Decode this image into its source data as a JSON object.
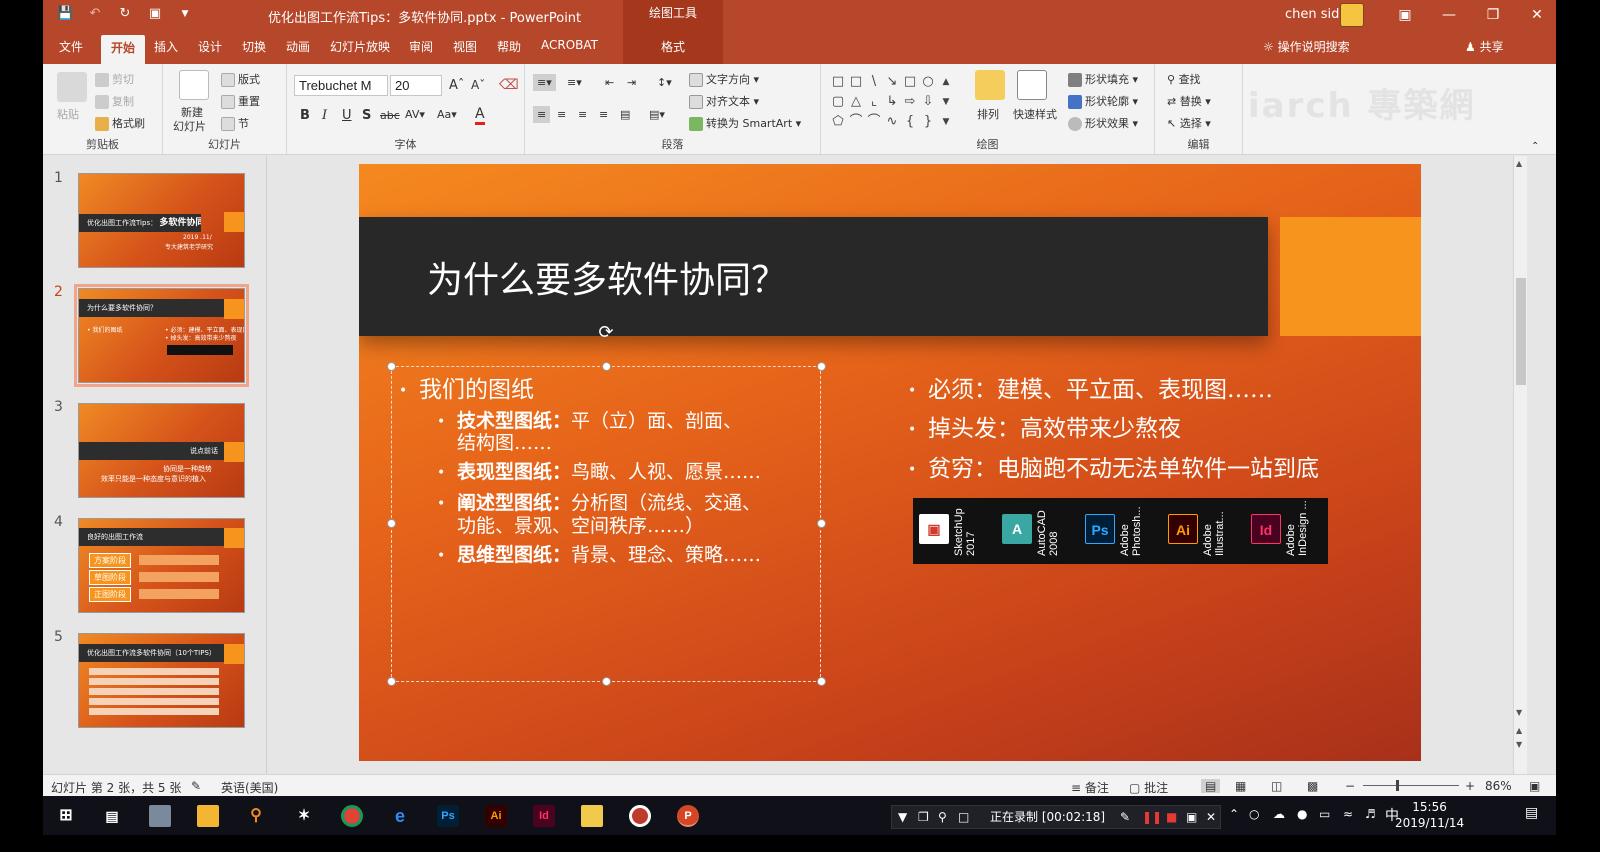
{
  "window": {
    "doc_title": "优化出图工作流Tips：多软件协同.pptx  -  PowerPoint",
    "contextual_tab_group": "绘图工具",
    "user_name": "chen sid"
  },
  "tabs": [
    "文件",
    "开始",
    "插入",
    "设计",
    "切换",
    "动画",
    "幻灯片放映",
    "审阅",
    "视图",
    "帮助",
    "ACROBAT",
    "格式"
  ],
  "tell_me": "操作说明搜索",
  "share": "共享",
  "ribbon": {
    "clipboard": {
      "label": "剪贴板",
      "paste": "粘贴",
      "cut": "剪切",
      "copy": "复制",
      "format_painter": "格式刷"
    },
    "slides": {
      "label": "幻灯片",
      "new_slide_1": "新建",
      "new_slide_2": "幻灯片",
      "layout": "版式",
      "reset": "重置",
      "section": "节"
    },
    "font": {
      "label": "字体",
      "font_name": "Trebuchet M",
      "font_size": "20"
    },
    "paragraph": {
      "label": "段落",
      "text_direction": "文字方向",
      "align_text": "对齐文本",
      "smartart": "转换为 SmartArt"
    },
    "drawing": {
      "label": "绘图",
      "arrange": "排列",
      "quick_styles": "快速样式",
      "shape_fill": "形状填充",
      "shape_outline": "形状轮廓",
      "shape_effects": "形状效果"
    },
    "editing": {
      "label": "编辑",
      "find": "查找",
      "replace": "替换",
      "select": "选择"
    },
    "watermark": "iarch 專築網"
  },
  "thumbnails": [
    {
      "num": "1",
      "bar": "优化出图工作流Tips：",
      "bar_big": "多软件协同",
      "sub1": "2019 .11/",
      "sub2": "专大建筑老学研究"
    },
    {
      "num": "2",
      "bar": "为什么要多软件协同？",
      "line1": "• 我们的图纸",
      "line2": "• 必须：建模、平立面、表现图……",
      "line3": "• 掉头发：高效带来少熬夜"
    },
    {
      "num": "3",
      "bar": "说点前话",
      "line1": "协同是一种趋势",
      "line2": "效率只能是一种态度与意识的植入"
    },
    {
      "num": "4",
      "bar": "良好的出图工作流",
      "step1": "方案阶段",
      "step2": "草图阶段",
      "step3": "正图阶段"
    },
    {
      "num": "5",
      "bar": "优化出图工作流多软件协同（10个TIPS）"
    }
  ],
  "slide": {
    "title": "为什么要多软件协同？",
    "left_top": "我们的图纸",
    "left_items": [
      {
        "bold": "技术型图纸：",
        "text": "平（立）面、剖面、",
        "cont": "结构图……"
      },
      {
        "bold": "表现型图纸：",
        "text": "鸟瞰、人视、愿景……"
      },
      {
        "bold": "阐述型图纸：",
        "text": "分析图（流线、交通、",
        "cont": "功能、景观、空间秩序……）"
      },
      {
        "bold": "思维型图纸：",
        "text": "背景、理念、策略……"
      }
    ],
    "right_items": [
      "必须：建模、平立面、表现图……",
      "掉头发：高效带来少熬夜",
      "贫穷：电脑跑不动无法单软件一站到底"
    ],
    "software": [
      {
        "name1": "SketchUp",
        "name2": "2017",
        "icon": "sketchup-icon",
        "color": "#d33a2c"
      },
      {
        "name1": "AutoCAD",
        "name2": "2008",
        "icon": "autocad-icon",
        "color": "#3aa7a3"
      },
      {
        "name1": "Adobe",
        "name2": "Photosh...",
        "icon": "photoshop-icon",
        "glyph": "Ps",
        "color": "#31a8ff"
      },
      {
        "name1": "Adobe",
        "name2": "Illustrat...",
        "icon": "illustrator-icon",
        "glyph": "Ai",
        "color": "#ff9a00"
      },
      {
        "name1": "Adobe",
        "name2": "InDesign ...",
        "icon": "indesign-icon",
        "glyph": "Id",
        "color": "#ff3366"
      }
    ]
  },
  "status": {
    "slide_info": "幻灯片 第 2 张，共 5 张",
    "language": "英语(美国)",
    "notes": "备注",
    "comments": "批注",
    "zoom": "86%"
  },
  "taskbar": {
    "recording": "正在录制 [00:02:18]",
    "ime": "中",
    "time": "15:56",
    "date": "2019/11/14"
  }
}
